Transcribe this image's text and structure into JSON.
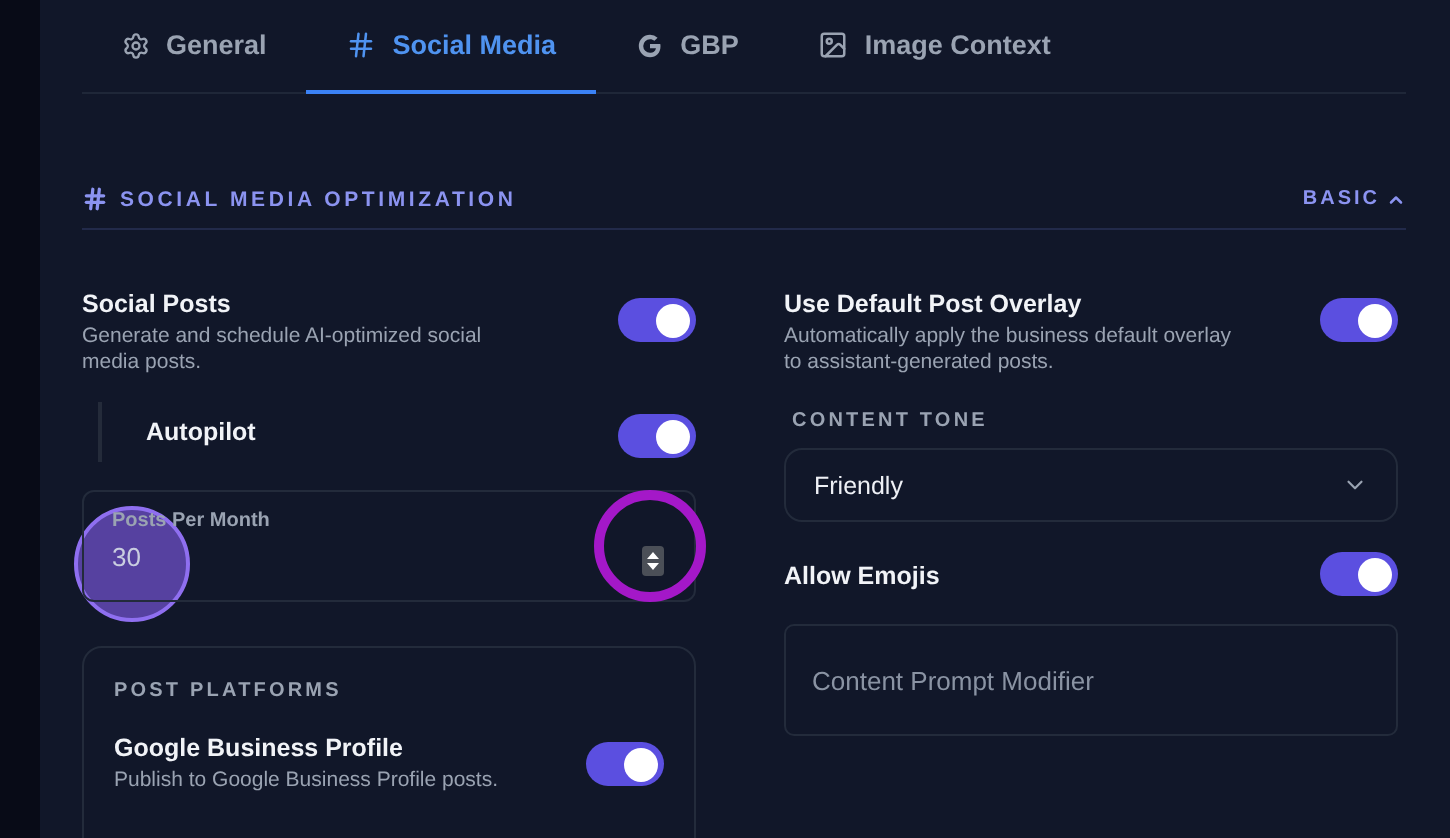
{
  "tabs": [
    {
      "label": "General",
      "selected": false
    },
    {
      "label": "Social Media",
      "selected": true
    },
    {
      "label": "GBP",
      "selected": false
    },
    {
      "label": "Image Context",
      "selected": false
    }
  ],
  "section": {
    "title": "SOCIAL MEDIA OPTIMIZATION",
    "mode": "BASIC",
    "expanded": true
  },
  "left": {
    "social_posts": {
      "title": "Social Posts",
      "description": "Generate and schedule AI-optimized social media posts.",
      "on": true
    },
    "autopilot": {
      "title": "Autopilot",
      "on": true
    },
    "posts_per_month": {
      "label": "Posts Per Month",
      "value": "30"
    },
    "platforms": {
      "title": "POST PLATFORMS",
      "items": [
        {
          "title": "Google Business Profile",
          "description": "Publish to Google Business Profile posts.",
          "on": true
        }
      ]
    }
  },
  "right": {
    "overlay": {
      "title": "Use Default Post Overlay",
      "description": "Automatically apply the business default overlay to assistant-generated posts.",
      "on": true
    },
    "tone": {
      "label": "CONTENT TONE",
      "value": "Friendly"
    },
    "emojis": {
      "title": "Allow Emojis",
      "on": true
    },
    "prompt": {
      "placeholder": "Content Prompt Modifier"
    }
  }
}
